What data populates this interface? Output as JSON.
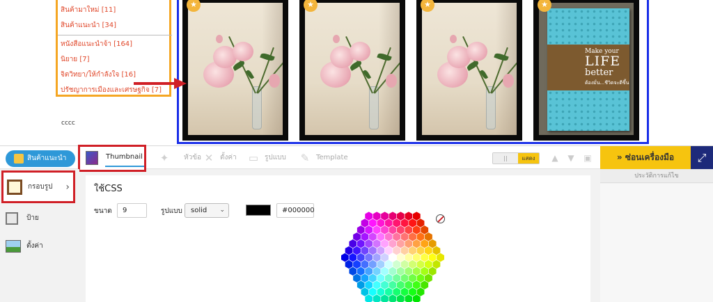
{
  "categories": {
    "group1": [
      "สินค้ามาใหม่ [11]",
      "สินค้าแนะนำ [34]"
    ],
    "group2": [
      "หนังสือแนะนำจ้า [164]",
      "นิยาย [7]",
      "จิตวิทยา/ให้กำลังใจ [16]",
      "ปรัชญาการเมืองและเศรษฐกิจ [7]"
    ]
  },
  "footer_text": "cccc",
  "products": [
    {
      "kind": "flowers",
      "star_icon": "star-icon"
    },
    {
      "kind": "flowers",
      "star_icon": "star-icon"
    },
    {
      "kind": "flowers",
      "star_icon": "star-icon"
    },
    {
      "kind": "book",
      "star_icon": "star-icon",
      "book": {
        "line1": "Make your",
        "line2": "LIFE",
        "line3": "better",
        "sub": "ต้องมั่น...ชีวิตจะดีขึ้น"
      }
    }
  ],
  "colors": {
    "highlight_frame": "#d01f26",
    "grid_frame": "#1a2fe8",
    "category_frame": "#f5a623",
    "accent_blue": "#2e98d8",
    "tools_yellow": "#f6c40f",
    "expand_navy": "#1d2a7a"
  },
  "editor": {
    "recommend_button": "สินค้าแนะนำ",
    "tabs": {
      "thumbnail": "Thumbnail",
      "heading": "หัวข้อ",
      "settings": "ตั้งค่า",
      "layout": "รูปแบบ",
      "template": "Template"
    },
    "toggle": {
      "off_label": "||",
      "on_label": "แสดง"
    },
    "tools_header": "ซ่อนเครื่องมือ",
    "tools_chevron": "»",
    "history": "ประวัติการแก้ไข",
    "sidenav": {
      "frame": "กรอบรูป",
      "label": "ป้าย",
      "settings": "ตั้งค่า",
      "chevron": "›"
    },
    "css_title": "ใช้CSS",
    "size_label": "ขนาด",
    "size_value": "9",
    "style_label": "รูปแบบ",
    "style_value": "solid",
    "color_value": "#000000"
  }
}
